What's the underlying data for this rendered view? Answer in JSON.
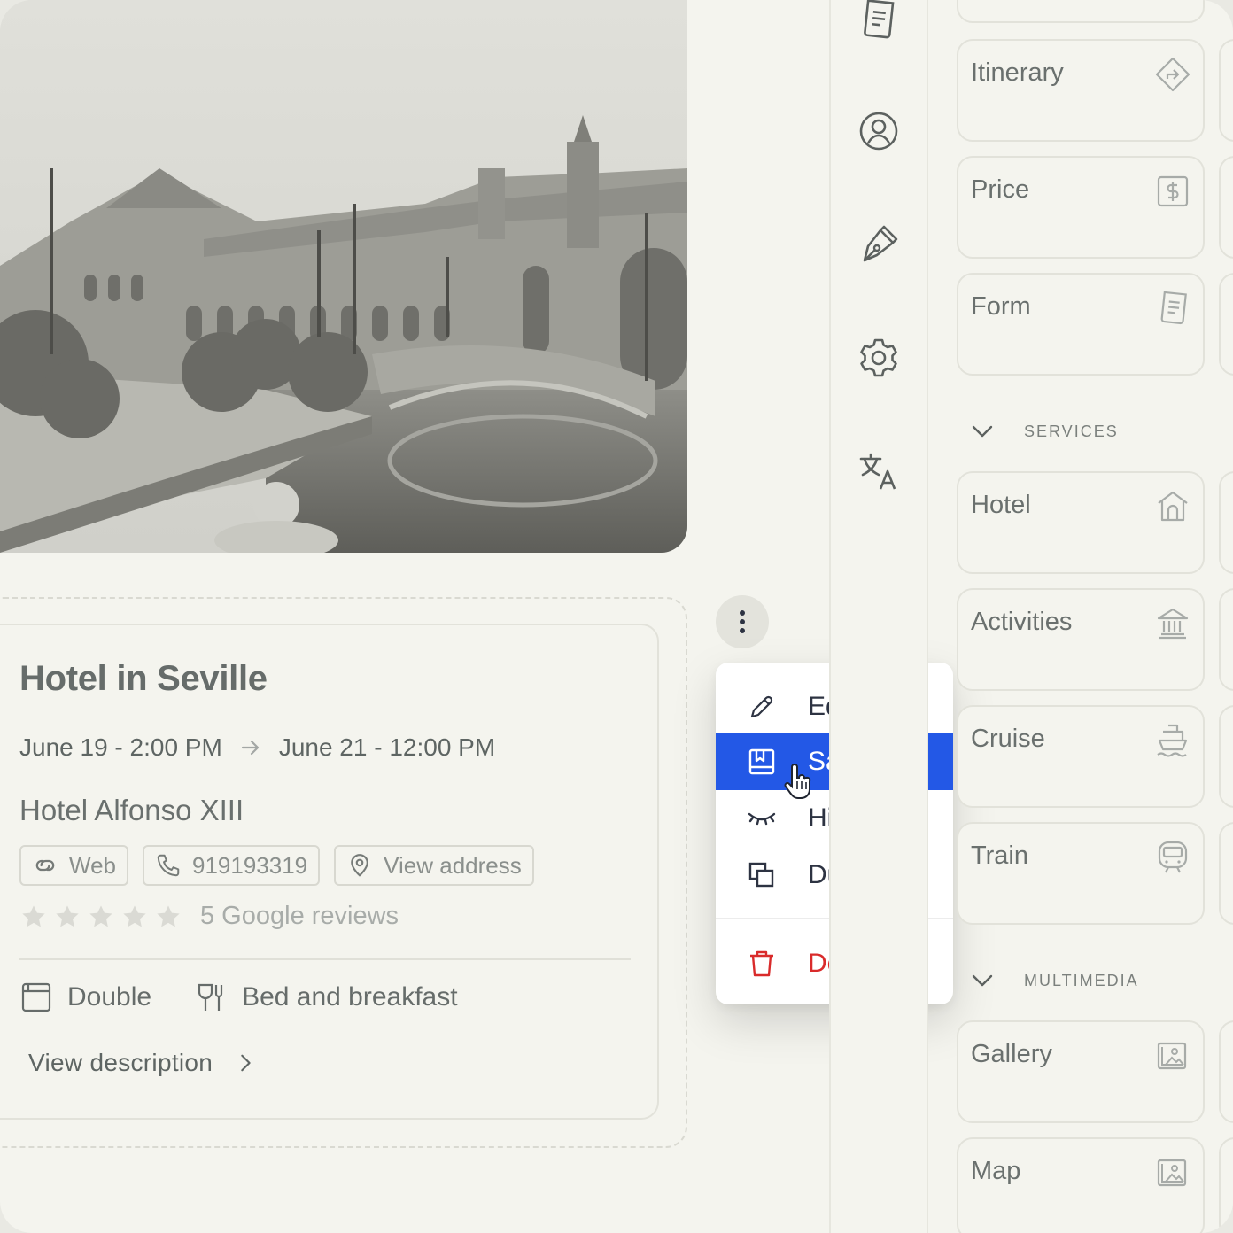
{
  "card": {
    "title": "Hotel in Seville",
    "check_in": "June 19 - 2:00 PM",
    "check_out": "June 21 - 12:00 PM",
    "hotel_name": "Hotel Alfonso XIII",
    "chips": {
      "web": "Web",
      "phone": "919193319",
      "address": "View address"
    },
    "rating": 5,
    "reviews": "5 Google reviews",
    "room_type": "Double",
    "board": "Bed and breakfast",
    "view_description": "View description"
  },
  "menu": {
    "edit": "Edit",
    "save": "Save",
    "hide": "Hide",
    "duplicate": "Duplicate",
    "delete": "Delete",
    "active_item": "save"
  },
  "rail": {
    "icons": [
      "document-icon",
      "user-icon",
      "pen-icon",
      "gear-icon",
      "translate-icon"
    ]
  },
  "panel": {
    "tiles_top": [
      {
        "label": "Itinerary",
        "icon": "directions-icon"
      },
      {
        "label": "Price",
        "icon": "dollar-icon"
      },
      {
        "label": "Form",
        "icon": "form-icon"
      }
    ],
    "services_heading": "SERVICES",
    "services": [
      {
        "label": "Hotel",
        "icon": "house-icon"
      },
      {
        "label": "Activities",
        "icon": "museum-icon"
      },
      {
        "label": "Cruise",
        "icon": "ship-icon"
      },
      {
        "label": "Train",
        "icon": "train-icon"
      }
    ],
    "multimedia_heading": "MULTIMEDIA",
    "multimedia": [
      {
        "label": "Gallery",
        "icon": "image-icon"
      },
      {
        "label": "Map",
        "icon": "image-icon"
      }
    ]
  },
  "colors": {
    "background": "#f4f4ee",
    "accent": "#2358e6",
    "danger": "#d92b2b",
    "text": "#5f6663"
  }
}
